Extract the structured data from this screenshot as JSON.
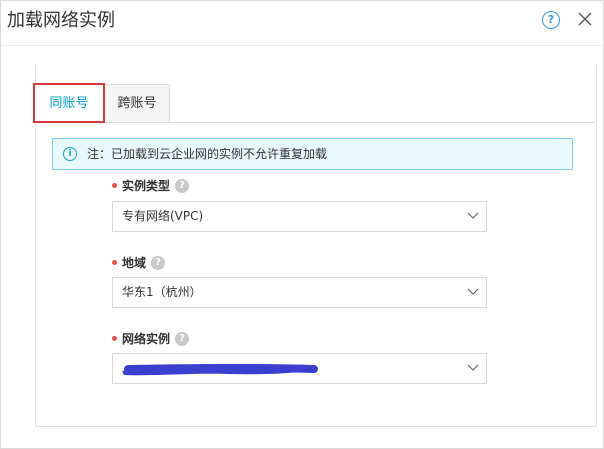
{
  "dialog": {
    "title": "加载网络实例",
    "help_icon": "question-circle-icon",
    "close_icon": "close-icon"
  },
  "tabs": [
    {
      "label": "同账号",
      "active": true
    },
    {
      "label": "跨账号",
      "active": false
    }
  ],
  "notice": {
    "icon": "info-icon",
    "text": "注：已加载到云企业网的实例不允许重复加载"
  },
  "form": {
    "instance_type": {
      "label": "实例类型",
      "value": "专有网络(VPC)"
    },
    "region": {
      "label": "地域",
      "value": "华东1（杭州）"
    },
    "network_instance": {
      "label": "网络实例",
      "value": ""
    }
  },
  "help_glyph": "?",
  "info_glyph": "i",
  "colors": {
    "accent": "#00a2ca",
    "highlight_border": "#d9363e",
    "required": "#e2504c",
    "notice_bg": "#e9f8fb",
    "notice_border": "#7fd3e3",
    "redaction": "#3a3fcf"
  }
}
